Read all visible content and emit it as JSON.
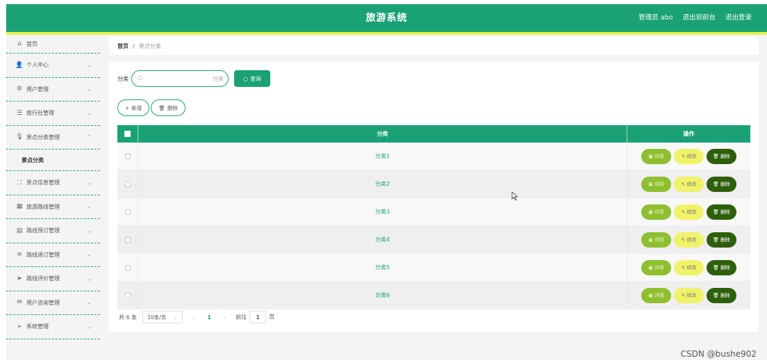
{
  "header": {
    "title": "旅游系统",
    "admin": "管理员 abo",
    "back_front": "退出到前台",
    "logout": "退出登录"
  },
  "sidebar": {
    "items": [
      {
        "label": "首页",
        "icon": "home-icon",
        "glyph": "⌂",
        "chevron": false
      },
      {
        "label": "个人中心",
        "icon": "user-icon",
        "glyph": "👤",
        "chevron": true
      },
      {
        "label": "用户管理",
        "icon": "gear-icon",
        "glyph": "⚙",
        "chevron": true
      },
      {
        "label": "旅行社管理",
        "icon": "list-icon",
        "glyph": "☰",
        "chevron": true
      },
      {
        "label": "景点分类管理",
        "icon": "mic-icon",
        "glyph": "🎙",
        "chevron": true,
        "expanded": true
      },
      {
        "label": "景点分类",
        "sub": true
      },
      {
        "label": "景点信息管理",
        "icon": "fullscreen-icon",
        "glyph": "⛶",
        "chevron": true
      },
      {
        "label": "旅游路线管理",
        "icon": "grid-icon",
        "glyph": "▦",
        "chevron": true
      },
      {
        "label": "路线预订管理",
        "icon": "clipboard-icon",
        "glyph": "▤",
        "chevron": true
      },
      {
        "label": "路线退订管理",
        "icon": "menu-icon",
        "glyph": "≡",
        "chevron": true
      },
      {
        "label": "路线评价管理",
        "icon": "send-icon",
        "glyph": "➤",
        "chevron": true
      },
      {
        "label": "用户咨询管理",
        "icon": "chat-icon",
        "glyph": "✉",
        "chevron": true
      },
      {
        "label": "系统管理",
        "icon": "navigation-icon",
        "glyph": "➢",
        "chevron": true
      }
    ]
  },
  "breadcrumb": {
    "home": "首页",
    "separator": "/",
    "current": "景点分类"
  },
  "search": {
    "label": "分类",
    "placeholder": "分类",
    "value": "",
    "button": "查询"
  },
  "actions": {
    "add": "新增",
    "delete": "删除"
  },
  "table": {
    "headers": {
      "name": "分类",
      "ops": "操作"
    },
    "rows": [
      "分类1",
      "分类2",
      "分类3",
      "分类4",
      "分类5",
      "分类6"
    ],
    "op_labels": {
      "detail": "详情",
      "edit": "修改",
      "delete": "删除"
    }
  },
  "pagination": {
    "total": "共 6 条",
    "page_size": "10条/页",
    "current_page": "1",
    "goto_label": "前往",
    "goto_value": "1",
    "page_suffix": "页"
  },
  "watermark": "CSDN @bushe902",
  "colors": {
    "primary": "#1aa176",
    "accent_yellow": "#e6f24a",
    "detail": "#8fbf2f",
    "edit": "#f0f26a",
    "delete": "#2e5f0a"
  }
}
